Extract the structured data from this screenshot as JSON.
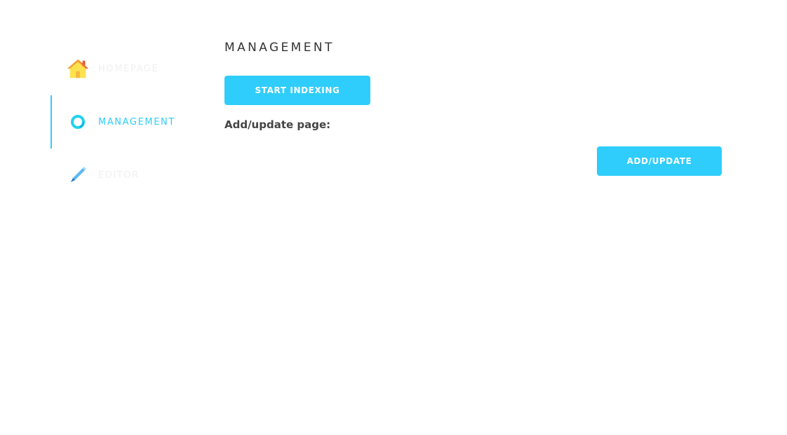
{
  "sidebar": {
    "items": [
      {
        "label": "Homepage",
        "icon": "home-icon",
        "active": false
      },
      {
        "label": "Management",
        "icon": "ring-icon",
        "active": true
      },
      {
        "label": "Editor",
        "icon": "pencil-icon",
        "active": false
      }
    ]
  },
  "main": {
    "title": "MANAGEMENT",
    "start_indexing_label": "START INDEXING",
    "add_update_page_label": "Add/update page:",
    "add_update_button_label": "ADD/UPDATE"
  },
  "colors": {
    "accent": "#2fcdfb",
    "title_text": "#333333",
    "label_text": "#444444"
  }
}
